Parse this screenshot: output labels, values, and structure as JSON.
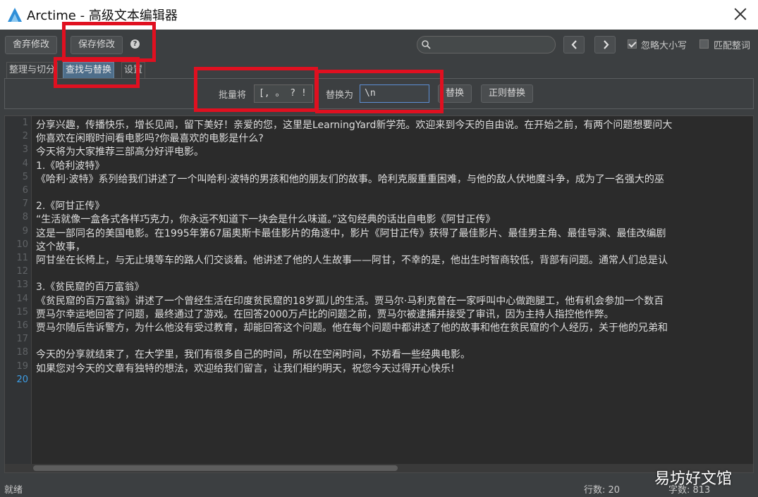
{
  "window": {
    "title": "Arctime - 高级文本编辑器"
  },
  "toolbar": {
    "discard_label": "舍弃修改",
    "save_label": "保存修改",
    "help_glyph": "?",
    "search_value": "",
    "prev_icon": "chevron-left-icon",
    "next_icon": "chevron-right-icon",
    "ignore_case_label": "忽略大小写",
    "ignore_case_checked": true,
    "whole_word_label": "匹配整词",
    "whole_word_checked": false
  },
  "tabs": [
    {
      "label": "整理与切分",
      "active": false
    },
    {
      "label": "查找与替换",
      "active": true
    },
    {
      "label": "设置",
      "active": false
    }
  ],
  "find_replace": {
    "batch_label": "批量将",
    "batch_value": "[, 。 ? ! ]",
    "replace_with_label": "替换为",
    "replace_with_value": "\\n",
    "replace_button": "替换",
    "regex_replace_button": "正则替换"
  },
  "editor": {
    "current_line": 20,
    "lines": [
      "分享兴趣，传播快乐，增长见闻，留下美好！亲爱的您，这里是LearningYard新学苑。欢迎来到今天的自由说。在开始之前，有两个问题想要问大",
      "你喜欢在闲暇时间看电影吗?你最喜欢的电影是什么?",
      "今天将为大家推荐三部高分好评电影。",
      "1.《哈利波特》",
      "《哈利·波特》系列给我们讲述了一个叫哈利·波特的男孩和他的朋友们的故事。哈利克服重重困难，与他的敌人伏地魔斗争，成为了一名强大的巫",
      "",
      "2.《阿甘正传》",
      "“生活就像一盒各式各样巧克力，你永远不知道下一块会是什么味道。”这句经典的话出自电影《阿甘正传》",
      "这是一部同名的美国电影。在1995年第67届奥斯卡最佳影片的角逐中，影片《阿甘正传》获得了最佳影片、最佳男主角、最佳导演、最佳改编剧",
      "这个故事，",
      "阿甘坐在长椅上，与无止境等车的路人们交谈着。他讲述了他的人生故事——阿甘，不幸的是，他出生时智商较低，背部有问题。通常人们总是认",
      "",
      "3.《贫民窟的百万富翁》",
      "《贫民窟的百万富翁》讲述了一个曾经生活在印度贫民窟的18岁孤儿的生活。贾马尔·马利克曾在一家呼叫中心做跑腿工，他有机会参加一个数百",
      "贾马尔幸运地回答了问题，最终通过了游戏。在回答2000万卢比的问题之前，贾马尔被逮捕并接受了审讯，因为主持人指控他作弊。",
      "贾马尔随后告诉警方，为什么他没有受过教育，却能回答这个问题。他在每个问题中都讲述了他的故事和他在贫民窟的个人经历，关于他的兄弟和",
      "",
      "今天的分享就结束了，在大学里，我们有很多自己的时间，所以在空闲时间，不妨看一些经典电影。",
      "如果您对今天的文章有独特的想法，欢迎给我们留言，让我们相约明天，祝您今天过得开心快乐!",
      ""
    ],
    "line_numbers": [
      "1",
      "2",
      "3",
      "4",
      "5",
      "6",
      "7",
      "8",
      "9",
      "10",
      "11",
      "12",
      "13",
      "14",
      "15",
      "16",
      "17",
      "18",
      "19",
      "20"
    ]
  },
  "status": {
    "text": "就绪",
    "line_count": "行数: 20",
    "char_count": "字数: 813"
  },
  "watermark": "易坊好文馆",
  "colors": {
    "highlight": "#e01020",
    "active_tab": "#4e6e8a",
    "current_line_number": "#3d9ee6"
  }
}
